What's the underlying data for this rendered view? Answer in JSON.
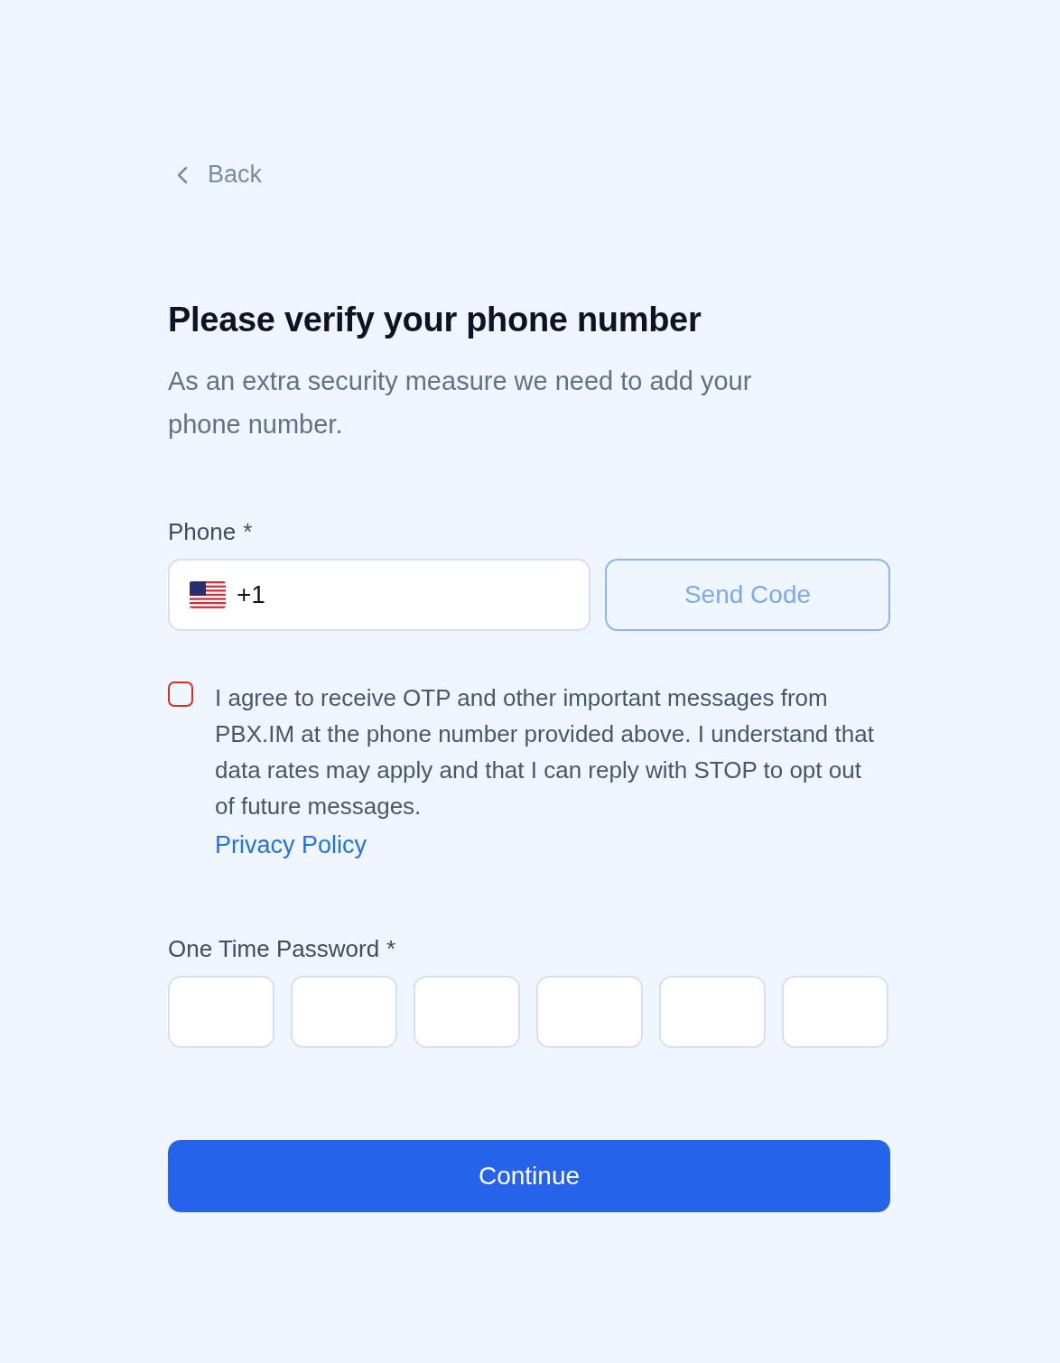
{
  "back": {
    "label": "Back"
  },
  "title": "Please verify your phone number",
  "subtitle": "As an extra security measure we need to add your phone number.",
  "phone": {
    "label": "Phone",
    "required_mark": "*",
    "value": "+1",
    "send_button": {
      "label": "Send Code",
      "disabled": true
    }
  },
  "consent": {
    "checked": false,
    "text": "I agree to receive OTP and other important messages from PBX.IM at the phone number provided above. I understand that data rates may apply and that I can reply with STOP to opt out of future messages.",
    "link": "Privacy Policy"
  },
  "otp": {
    "label": "One Time Password",
    "required_mark": "*",
    "boxes": [
      {
        "filled": false
      },
      {
        "filled": false
      },
      {
        "filled": false
      },
      {
        "filled": false
      },
      {
        "filled": false
      },
      {
        "filled": false
      }
    ]
  },
  "continue_button": {
    "label": "Continue"
  }
}
